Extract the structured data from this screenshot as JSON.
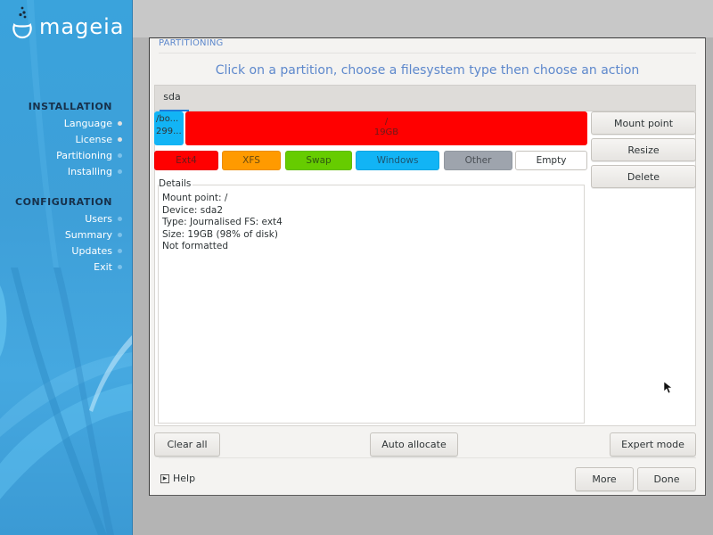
{
  "brand": {
    "logo_text": "mageia",
    "logo_icon": "mageia-cauldron-icon"
  },
  "sidebar": {
    "sections": [
      {
        "title": "INSTALLATION",
        "items": [
          {
            "label": "Language",
            "status": "done"
          },
          {
            "label": "License",
            "status": "done"
          },
          {
            "label": "Partitioning",
            "status": "current"
          },
          {
            "label": "Installing",
            "status": "pending"
          }
        ]
      },
      {
        "title": "CONFIGURATION",
        "items": [
          {
            "label": "Users",
            "status": "pending"
          },
          {
            "label": "Summary",
            "status": "pending"
          },
          {
            "label": "Updates",
            "status": "pending"
          },
          {
            "label": "Exit",
            "status": "pending"
          }
        ]
      }
    ]
  },
  "window": {
    "title": "PARTITIONING",
    "instruction": "Click on a partition, choose a filesystem type then choose an action",
    "tabs": [
      {
        "label": "sda",
        "selected": true
      }
    ],
    "partitions": [
      {
        "name": "/bo...",
        "size": "299...",
        "color": "#12b4f5",
        "fs": "Windows-colored"
      },
      {
        "name": "/",
        "size": "19GB",
        "color": "#ff0000",
        "fs": "Ext4"
      }
    ],
    "legend": [
      {
        "label": "Ext4",
        "color": "#ff0000",
        "text_color": "#6a1a1a"
      },
      {
        "label": "XFS",
        "color": "#ff9a00",
        "text_color": "#6a4a10"
      },
      {
        "label": "Swap",
        "color": "#66cc00",
        "text_color": "#2f5a10"
      },
      {
        "label": "Windows",
        "color": "#12b4f5",
        "text_color": "#1d5570"
      },
      {
        "label": "Other",
        "color": "#9ea4ad",
        "text_color": "#4a4f55"
      },
      {
        "label": "Empty",
        "color": "#ffffff",
        "text_color": "#2e3436"
      }
    ],
    "actions": {
      "mount_point": "Mount point",
      "resize": "Resize",
      "delete": "Delete"
    },
    "details": {
      "label": "Details",
      "lines": [
        "Mount point: /",
        "Device: sda2",
        "Type: Journalised FS: ext4",
        "Size: 19GB (98% of disk)",
        "Not formatted"
      ]
    },
    "bottom_buttons": {
      "clear_all": "Clear all",
      "auto_allocate": "Auto allocate",
      "expert_mode": "Expert mode"
    },
    "footer": {
      "help": "Help",
      "more": "More",
      "done": "Done"
    }
  }
}
